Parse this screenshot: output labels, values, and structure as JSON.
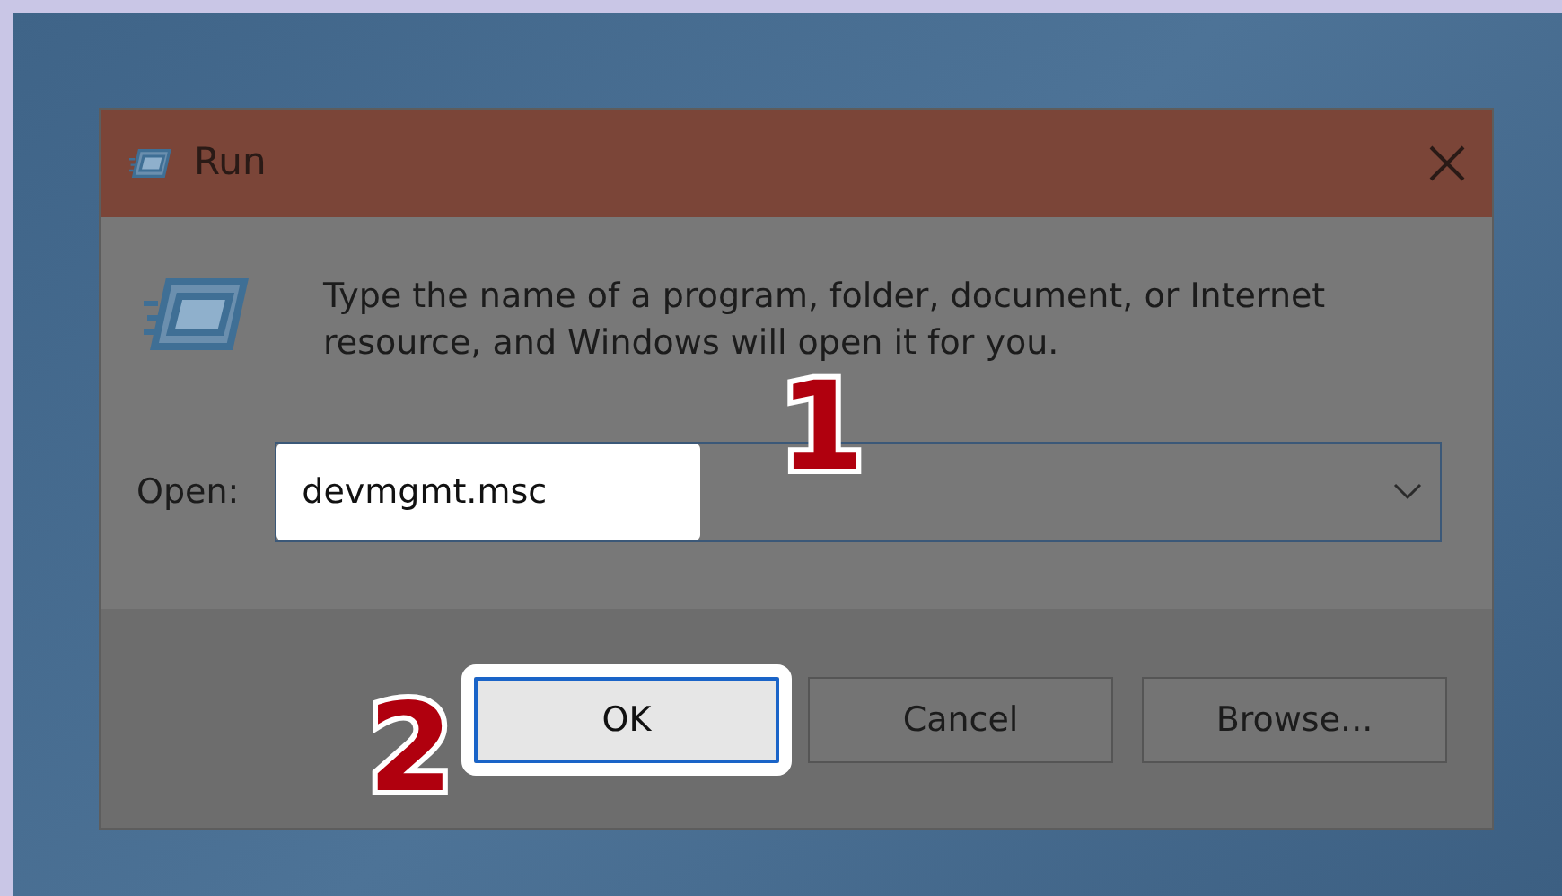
{
  "window": {
    "title": "Run"
  },
  "message": "Type the name of a program, folder, document, or Internet resource, and Windows will open it for you.",
  "open_field": {
    "label": "Open:",
    "value": "devmgmt.msc",
    "highlighted": true
  },
  "buttons": [
    {
      "label": "OK",
      "highlighted": true
    },
    {
      "label": "Cancel",
      "highlighted": false
    },
    {
      "label": "Browse...",
      "highlighted": false
    }
  ],
  "annotations": [
    {
      "label": "1"
    },
    {
      "label": "2"
    }
  ]
}
